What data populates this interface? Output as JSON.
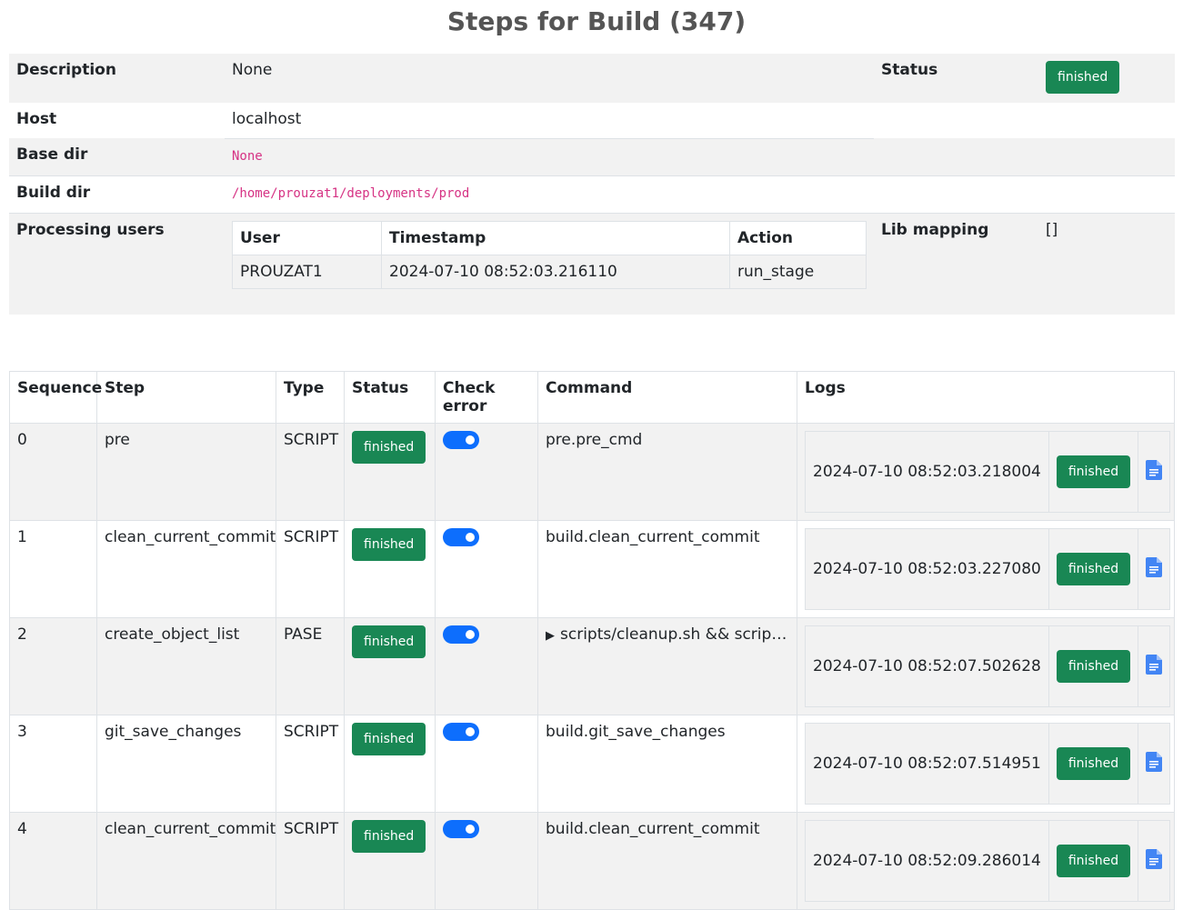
{
  "page": {
    "title": "Steps for Build (347)"
  },
  "info": {
    "description_label": "Description",
    "description_value": "None",
    "status_label": "Status",
    "status_value": "finished",
    "host_label": "Host",
    "host_value": "localhost",
    "base_dir_label": "Base dir",
    "base_dir_value": "None",
    "build_dir_label": "Build dir",
    "build_dir_value": "/home/prouzat1/deployments/prod",
    "processing_users_label": "Processing users",
    "lib_mapping_label": "Lib mapping",
    "lib_mapping_value": "[]",
    "users_table": {
      "headers": [
        "User",
        "Timestamp",
        "Action"
      ],
      "rows": [
        [
          "PROUZAT1",
          "2024-07-10 08:52:03.216110",
          "run_stage"
        ]
      ]
    }
  },
  "steps": {
    "headers": [
      "Sequence",
      "Step",
      "Type",
      "Status",
      "Check error",
      "Command",
      "Logs"
    ],
    "rows": [
      {
        "sequence": "0",
        "step": "pre",
        "type": "SCRIPT",
        "status": "finished",
        "check_error": true,
        "command": "pre.pre_cmd",
        "log_timestamp": "2024-07-10 08:52:03.218004",
        "log_status": "finished"
      },
      {
        "sequence": "1",
        "step": "clean_current_commit",
        "type": "SCRIPT",
        "status": "finished",
        "check_error": true,
        "command": "build.clean_current_commit",
        "log_timestamp": "2024-07-10 08:52:03.227080",
        "log_status": "finished"
      },
      {
        "sequence": "2",
        "step": "create_object_list",
        "type": "PASE",
        "status": "finished",
        "check_error": true,
        "command": "scripts/cleanup.sh && scripts ...",
        "log_timestamp": "2024-07-10 08:52:07.502628",
        "log_status": "finished"
      },
      {
        "sequence": "3",
        "step": "git_save_changes",
        "type": "SCRIPT",
        "status": "finished",
        "check_error": true,
        "command": "build.git_save_changes",
        "log_timestamp": "2024-07-10 08:52:07.514951",
        "log_status": "finished"
      },
      {
        "sequence": "4",
        "step": "clean_current_commit",
        "type": "SCRIPT",
        "status": "finished",
        "check_error": true,
        "command": "build.clean_current_commit",
        "log_timestamp": "2024-07-10 08:52:09.286014",
        "log_status": "finished"
      }
    ]
  },
  "icons": {
    "log_icon": "document-icon",
    "toggle_color": "#0d6efd",
    "badge_color": "#198754"
  }
}
